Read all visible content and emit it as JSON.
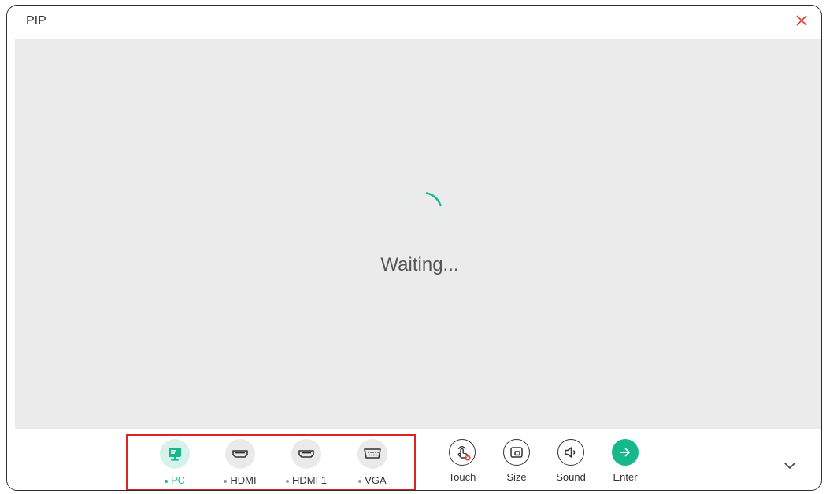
{
  "window": {
    "title": "PIP"
  },
  "preview": {
    "status_text": "Waiting..."
  },
  "sources": [
    {
      "label": "PC",
      "icon": "monitor-icon",
      "active": true
    },
    {
      "label": "HDMI",
      "icon": "hdmi-port-icon",
      "active": false
    },
    {
      "label": "HDMI 1",
      "icon": "hdmi-port-icon",
      "active": false
    },
    {
      "label": "VGA",
      "icon": "vga-port-icon",
      "active": false
    }
  ],
  "controls": [
    {
      "label": "Touch",
      "icon": "touch-disabled-icon"
    },
    {
      "label": "Size",
      "icon": "resize-window-icon"
    },
    {
      "label": "Sound",
      "icon": "speaker-icon"
    },
    {
      "label": "Enter",
      "icon": "arrow-right-icon"
    }
  ],
  "colors": {
    "accent": "#17b98c",
    "close": "#e0473c",
    "highlight": "#e02222",
    "preview_bg": "#ebebeb"
  }
}
